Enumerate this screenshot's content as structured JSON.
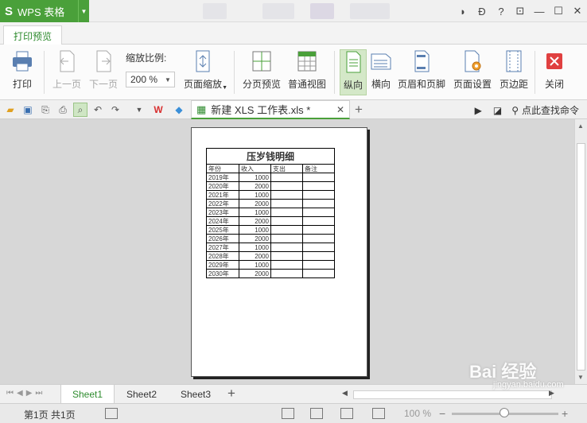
{
  "app": {
    "logo": "S",
    "name": "WPS 表格"
  },
  "ribbon_tab": "打印预览",
  "ribbon": {
    "print": "打印",
    "prev_page": "上一页",
    "next_page": "下一页",
    "zoom_label": "缩放比例:",
    "zoom_value": "200 %",
    "page_zoom": "页面缩放",
    "page_break_preview": "分页预览",
    "normal_view": "普通视图",
    "portrait": "纵向",
    "landscape": "横向",
    "header_footer": "页眉和页脚",
    "page_setup": "页面设置",
    "margins": "页边距",
    "close": "关闭"
  },
  "document_tab": {
    "title": "新建 XLS 工作表.xls *"
  },
  "search_cmd": "点此查找命令",
  "sheet": {
    "title": "压岁钱明细",
    "headers": [
      "年份",
      "收入",
      "支出",
      "备注"
    ],
    "rows": [
      [
        "2019年",
        "1000",
        "",
        ""
      ],
      [
        "2020年",
        "2000",
        "",
        ""
      ],
      [
        "2021年",
        "1000",
        "",
        ""
      ],
      [
        "2022年",
        "2000",
        "",
        ""
      ],
      [
        "2023年",
        "1000",
        "",
        ""
      ],
      [
        "2024年",
        "2000",
        "",
        ""
      ],
      [
        "2025年",
        "1000",
        "",
        ""
      ],
      [
        "2026年",
        "2000",
        "",
        ""
      ],
      [
        "2027年",
        "1000",
        "",
        ""
      ],
      [
        "2028年",
        "2000",
        "",
        ""
      ],
      [
        "2029年",
        "1000",
        "",
        ""
      ],
      [
        "2030年",
        "2000",
        "",
        ""
      ]
    ]
  },
  "sheet_tabs": [
    "Sheet1",
    "Sheet2",
    "Sheet3"
  ],
  "status": {
    "page_info": "第1页 共1页",
    "zoom": "100 %"
  },
  "watermark": {
    "text": "Bai 经验",
    "sub": "jingyan.baidu.com"
  },
  "colors": {
    "brand_green": "#4aa03a",
    "active_green": "#2e8b2e"
  }
}
